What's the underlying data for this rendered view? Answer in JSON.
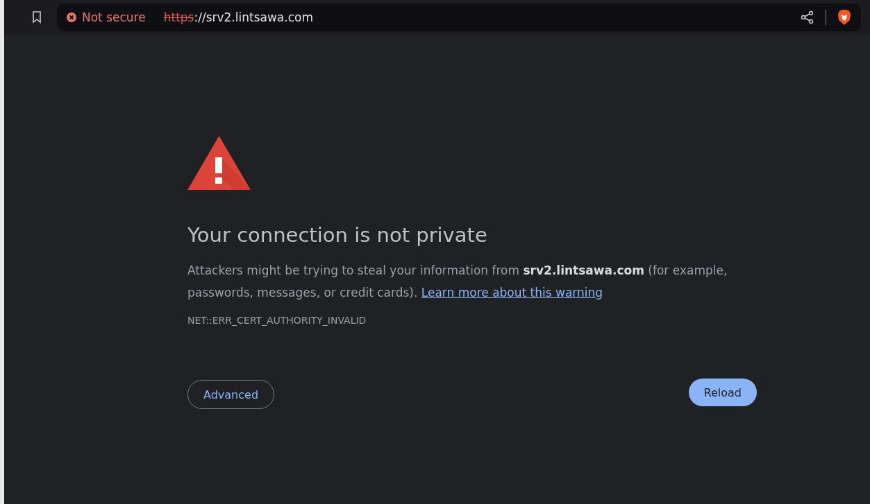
{
  "address_bar": {
    "security_status": "Not secure",
    "scheme": "https",
    "url_rest": "://srv2.lintsawa.com"
  },
  "error_page": {
    "title": "Your connection is not private",
    "message": "Attackers might be trying to steal your information from **srv2.lintsawa.com** (for example, passwords, messages, or credit cards). ",
    "link": "Learn more about this warning",
    "error_code": "NET::ERR_CERT_AUTHORITY_INVALID",
    "buttons": [
      {
        "label": "Advanced",
        "kind": "outline"
      },
      {
        "label": "Reload",
        "kind": "primary"
      }
    ]
  }
}
